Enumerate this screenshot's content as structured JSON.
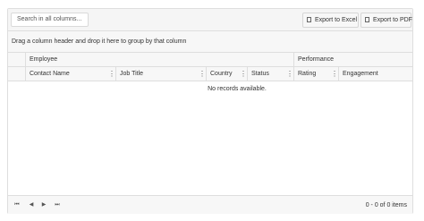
{
  "toolbar": {
    "search_placeholder": "Search in all columns...",
    "export_excel": "Export to Excel",
    "export_pdf": "Export to PDF"
  },
  "group_panel": {
    "text": "Drag a column header and drop it here to group by that column"
  },
  "header": {
    "bands": [
      {
        "label": "Employee"
      },
      {
        "label": "Performance"
      }
    ],
    "columns": [
      {
        "label": "Contact Name"
      },
      {
        "label": "Job Title"
      },
      {
        "label": "Country"
      },
      {
        "label": "Status"
      },
      {
        "label": "Rating"
      },
      {
        "label": "Engagement"
      }
    ]
  },
  "body": {
    "empty_text": "No records available."
  },
  "pager": {
    "first": "⏮",
    "prev": "◀",
    "next": "▶",
    "last": "⏭",
    "info": "0 - 0 of 0 items"
  }
}
